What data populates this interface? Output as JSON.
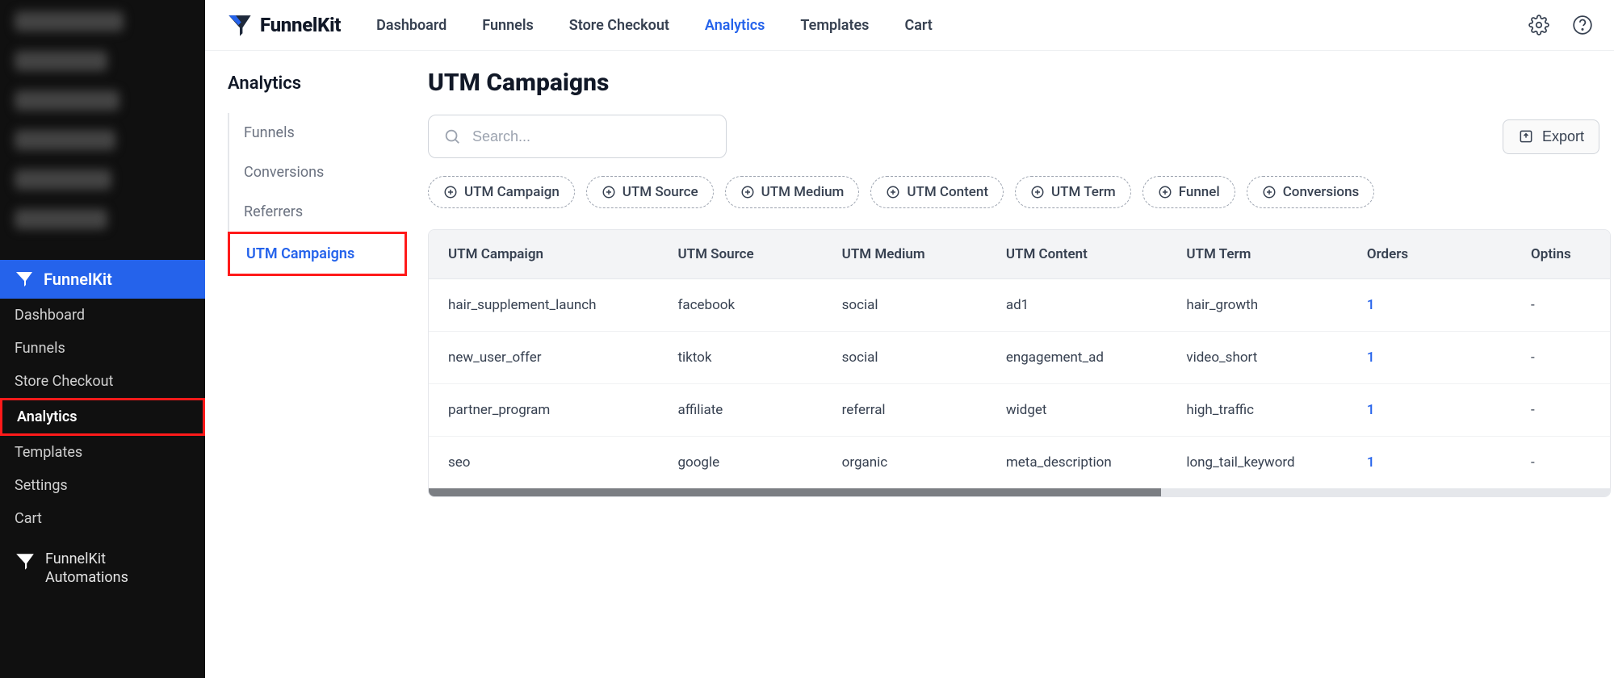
{
  "wp_sidebar": {
    "brand": "FunnelKit",
    "items": [
      "Dashboard",
      "Funnels",
      "Store Checkout",
      "Analytics",
      "Templates",
      "Settings",
      "Cart"
    ],
    "active_index": 3,
    "automations": "FunnelKit Automations"
  },
  "topbar": {
    "brand": "FunnelKit",
    "nav": [
      "Dashboard",
      "Funnels",
      "Store Checkout",
      "Analytics",
      "Templates",
      "Cart"
    ],
    "active_index": 3
  },
  "sub_sidebar": {
    "title": "Analytics",
    "items": [
      "Funnels",
      "Conversions",
      "Referrers",
      "UTM Campaigns"
    ],
    "active_index": 3
  },
  "page": {
    "title": "UTM Campaigns",
    "search_placeholder": "Search...",
    "export_label": "Export"
  },
  "filters": [
    "UTM Campaign",
    "UTM Source",
    "UTM Medium",
    "UTM Content",
    "UTM Term",
    "Funnel",
    "Conversions"
  ],
  "table": {
    "headers": [
      "UTM Campaign",
      "UTM Source",
      "UTM Medium",
      "UTM Content",
      "UTM Term",
      "Orders",
      "Optins"
    ],
    "rows": [
      {
        "campaign": "hair_supplement_launch",
        "source": "facebook",
        "medium": "social",
        "content": "ad1",
        "term": "hair_growth",
        "orders": "1",
        "optins": "-"
      },
      {
        "campaign": "new_user_offer",
        "source": "tiktok",
        "medium": "social",
        "content": "engagement_ad",
        "term": "video_short",
        "orders": "1",
        "optins": "-"
      },
      {
        "campaign": "partner_program",
        "source": "affiliate",
        "medium": "referral",
        "content": "widget",
        "term": "high_traffic",
        "orders": "1",
        "optins": "-"
      },
      {
        "campaign": "seo",
        "source": "google",
        "medium": "organic",
        "content": "meta_description",
        "term": "long_tail_keyword",
        "orders": "1",
        "optins": "-"
      }
    ]
  }
}
